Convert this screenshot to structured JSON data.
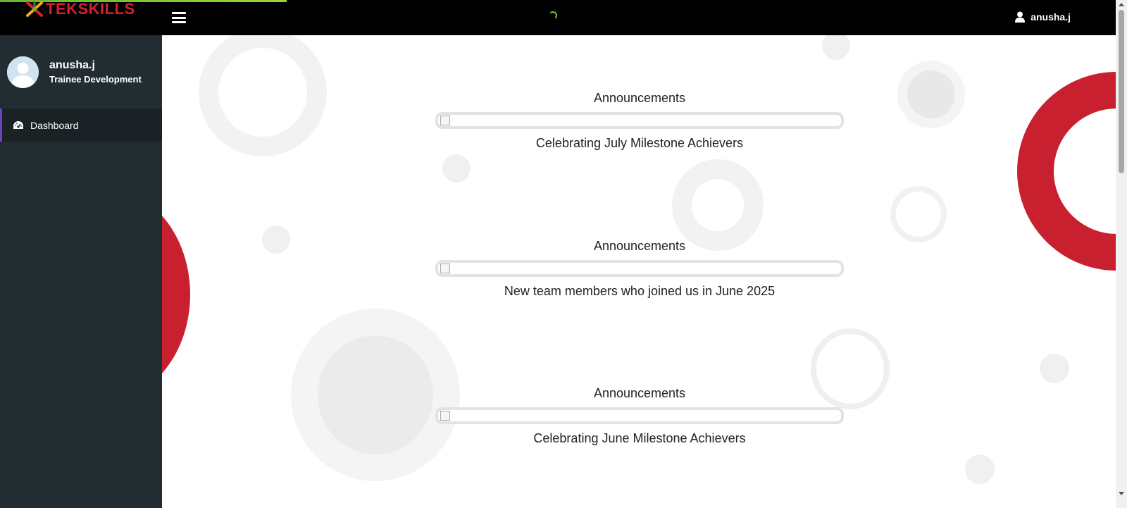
{
  "header": {
    "logo_text": "TEKSKILLS",
    "username": "anusha.j",
    "colors": {
      "bar": "#000000",
      "brand_red": "#d42030",
      "progress": "#7cc242"
    }
  },
  "sidebar": {
    "user_name": "anusha.j",
    "user_role": "Trainee Development",
    "items": [
      {
        "label": "Dashboard",
        "icon": "dashboard-icon",
        "active": true
      }
    ]
  },
  "main": {
    "announcements": [
      {
        "title": "Announcements",
        "caption": "Celebrating July Milestone Achievers"
      },
      {
        "title": "Announcements",
        "caption": "New team members who joined us in June 2025"
      },
      {
        "title": "Announcements",
        "caption": "Celebrating June Milestone Achievers"
      }
    ]
  }
}
